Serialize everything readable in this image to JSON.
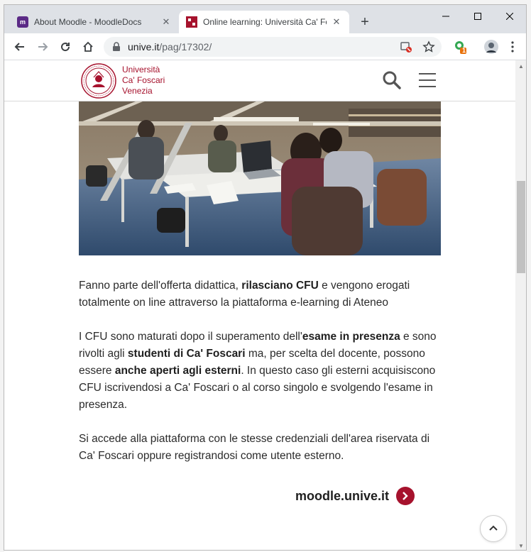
{
  "browser": {
    "tabs": [
      {
        "title": "About Moodle - MoodleDocs",
        "favicon": "moodle-icon",
        "active": false
      },
      {
        "title": "Online learning: Università Ca' Fo",
        "favicon": "unive-icon",
        "active": true
      }
    ],
    "url_host": "unive.it",
    "url_path": "/pag/17302/",
    "extension_badge": "1",
    "colors": {
      "tabstrip": "#dee1e6",
      "omnibox": "#f1f3f4"
    }
  },
  "site": {
    "logo": {
      "line1": "Università",
      "line2": "Ca' Foscari",
      "line3": "Venezia",
      "color": "#a6122d"
    },
    "hero_image": "students-studying-in-library-photo"
  },
  "content": {
    "p1_a": "Fanno parte dell'offerta didattica, ",
    "p1_b": "rilasciano CFU",
    "p1_c": " e vengono erogati totalmente on line attraverso la piattaforma e-learning di Ateneo",
    "p2_a": "I CFU sono maturati dopo il superamento dell'",
    "p2_b": "esame in presenza",
    "p2_c": " e sono rivolti agli ",
    "p2_d": "studenti di Ca' Foscari",
    "p2_e": " ma, per scelta del docente, possono essere ",
    "p2_f": "anche aperti agli esterni",
    "p2_g": ". In questo caso gli esterni acquisiscono CFU iscrivendosi a Ca' Foscari o al corso singolo e svolgendo l'esame in presenza.",
    "p3": "Si accede alla piattaforma con le stesse credenziali dell'area riservata di Ca' Foscari oppure registrandosi come utente esterno.",
    "cta_label": "moodle.unive.it",
    "accent": "#a6122d"
  }
}
